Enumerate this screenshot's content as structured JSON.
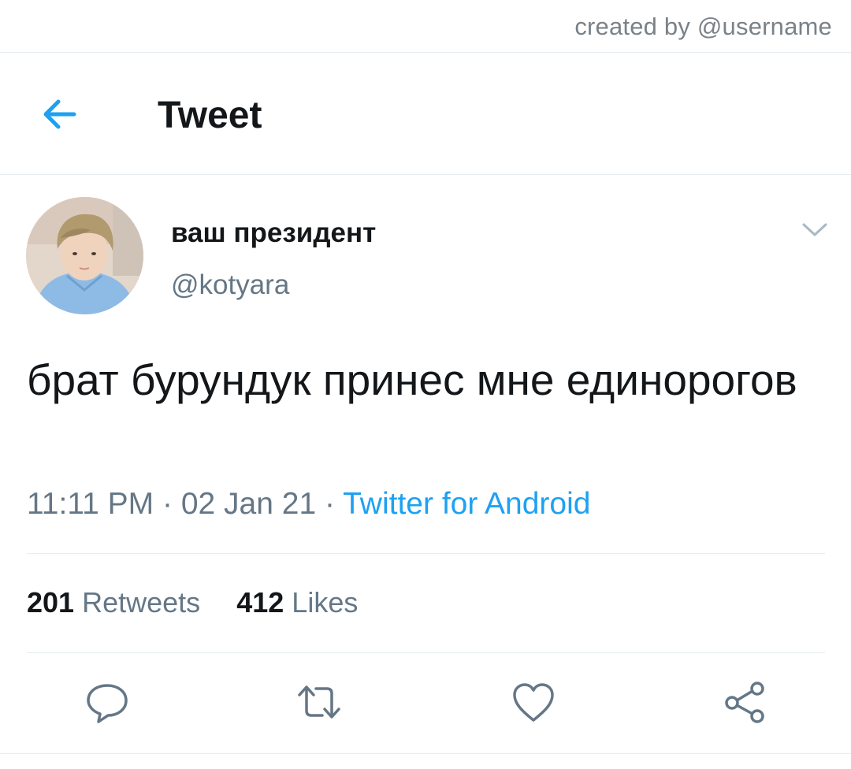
{
  "credit": "created by @username",
  "header": {
    "title": "Tweet",
    "back_icon": "arrow-left-icon"
  },
  "tweet": {
    "display_name": "ваш президент",
    "handle": "@kotyara",
    "text": "брат бурундук принес мне единорогов",
    "time": "11:11 PM",
    "separator": "·",
    "date": "02 Jan 21",
    "source": "Twitter for Android",
    "retweets_count": "201",
    "retweets_label": "Retweets",
    "likes_count": "412",
    "likes_label": "Likes"
  },
  "actions": [
    "reply-icon",
    "retweet-icon",
    "like-icon",
    "share-icon"
  ],
  "colors": {
    "accent": "#1da1f2",
    "text": "#14171a",
    "secondary": "#657786",
    "divider": "#e6ecf0"
  }
}
